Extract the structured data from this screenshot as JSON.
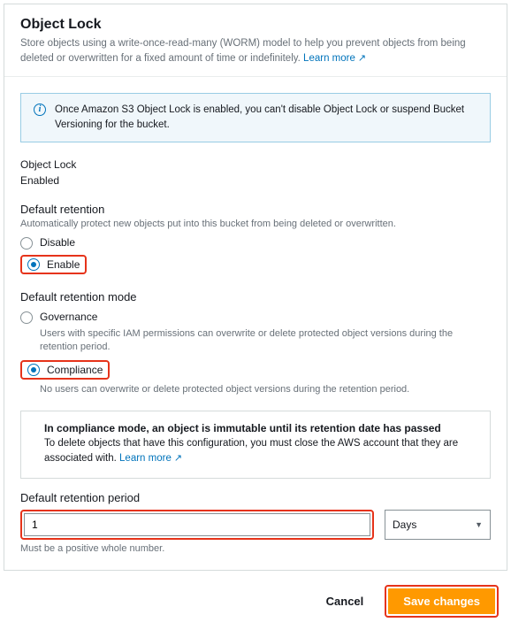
{
  "header": {
    "title": "Object Lock",
    "description": "Store objects using a write-once-read-many (WORM) model to help you prevent objects from being deleted or overwritten for a fixed amount of time or indefinitely.",
    "learn_more": "Learn more"
  },
  "info_banner": {
    "text": "Once Amazon S3 Object Lock is enabled, you can't disable Object Lock or suspend Bucket Versioning for the bucket."
  },
  "object_lock": {
    "label": "Object Lock",
    "value": "Enabled"
  },
  "default_retention": {
    "title": "Default retention",
    "hint": "Automatically protect new objects put into this bucket from being deleted or overwritten.",
    "options": {
      "disable": "Disable",
      "enable": "Enable"
    },
    "selected": "enable"
  },
  "retention_mode": {
    "title": "Default retention mode",
    "options": {
      "governance": {
        "label": "Governance",
        "hint": "Users with specific IAM permissions can overwrite or delete protected object versions during the retention period."
      },
      "compliance": {
        "label": "Compliance",
        "hint": "No users can overwrite or delete protected object versions during the retention period."
      }
    },
    "selected": "compliance"
  },
  "compliance_warning": {
    "title": "In compliance mode, an object is immutable until its retention date has passed",
    "text": "To delete objects that have this configuration, you must close the AWS account that they are associated with.",
    "learn_more": "Learn more"
  },
  "retention_period": {
    "label": "Default retention period",
    "value": "1",
    "unit": "Days",
    "helper": "Must be a positive whole number."
  },
  "footer": {
    "cancel": "Cancel",
    "save": "Save changes"
  }
}
